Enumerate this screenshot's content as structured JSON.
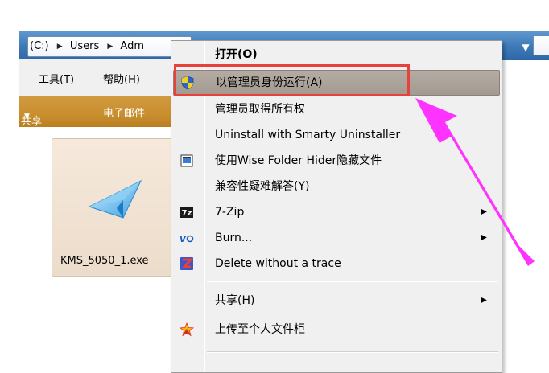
{
  "explorer": {
    "breadcrumb": [
      {
        "label": "(C:)"
      },
      {
        "label": "Users"
      },
      {
        "label": "Adm"
      }
    ],
    "menu": {
      "tools": "工具(T)",
      "help": "帮助(H)"
    },
    "toolbar": {
      "share": "共享",
      "email": "电子邮件"
    },
    "file": {
      "name": "KMS_5050_1.exe",
      "icon": "paper-plane-icon"
    }
  },
  "context_menu": {
    "items": [
      {
        "label": "打开(O)",
        "bold": true,
        "icon": ""
      },
      {
        "label": "以管理员身份运行(A)",
        "icon": "uac-shield-icon",
        "highlighted": true
      },
      {
        "label": "管理员取得所有权",
        "icon": ""
      },
      {
        "label": "Uninstall with Smarty Uninstaller",
        "icon": ""
      },
      {
        "label": "使用Wise Folder Hider隐藏文件",
        "icon": "wise-folder-hider-icon"
      },
      {
        "label": "兼容性疑难解答(Y)",
        "icon": ""
      },
      {
        "label": "7-Zip",
        "icon": "7zip-icon",
        "submenu": true
      },
      {
        "label": "Burn...",
        "icon": "burn-icon",
        "submenu": true
      },
      {
        "label": "Delete without a trace",
        "icon": "zip-z-icon"
      },
      {
        "label": "共享(H)",
        "icon": "",
        "submenu": true
      },
      {
        "label": "上传至个人文件柜",
        "icon": "star-upload-icon"
      }
    ]
  },
  "colors": {
    "annotation_box": "#e8413b",
    "annotation_arrow": "#ff33ff",
    "highlight": "#a9a097",
    "toolbar": "#c98e2e",
    "addressbar": "#3d78b6"
  }
}
